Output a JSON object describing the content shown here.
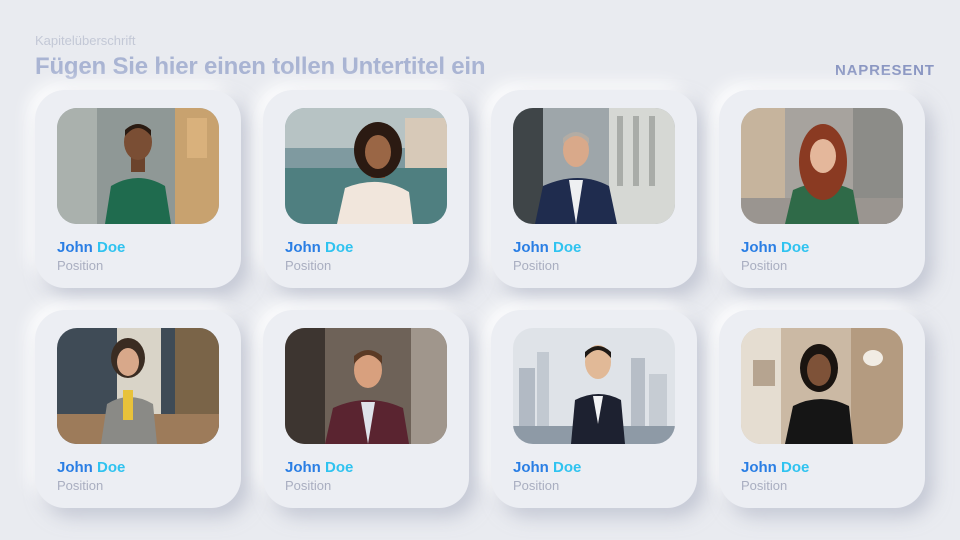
{
  "header": {
    "kicker": "Kapitelüberschrift",
    "title": "Fügen Sie hier einen tollen Untertitel ein",
    "brand": "NAPRESENT"
  },
  "team": [
    {
      "first": "John",
      "last": "Doe",
      "position": "Position",
      "photo": "portrait-man-green-sweater"
    },
    {
      "first": "John",
      "last": "Doe",
      "position": "Position",
      "photo": "portrait-woman-white-blouse"
    },
    {
      "first": "John",
      "last": "Doe",
      "position": "Position",
      "photo": "portrait-man-navy-suit"
    },
    {
      "first": "John",
      "last": "Doe",
      "position": "Position",
      "photo": "portrait-woman-green-sweater"
    },
    {
      "first": "John",
      "last": "Doe",
      "position": "Position",
      "photo": "portrait-woman-plaid-blazer"
    },
    {
      "first": "John",
      "last": "Doe",
      "position": "Position",
      "photo": "portrait-man-burgundy-suit"
    },
    {
      "first": "John",
      "last": "Doe",
      "position": "Position",
      "photo": "portrait-woman-black-suit"
    },
    {
      "first": "John",
      "last": "Doe",
      "position": "Position",
      "photo": "portrait-woman-black-blazer"
    }
  ],
  "colors": {
    "background": "#e9ebf0",
    "title": "#a9b4d3",
    "first_name": "#2a7ee4",
    "last_name": "#2fc3f0",
    "position": "#a9aec0"
  }
}
